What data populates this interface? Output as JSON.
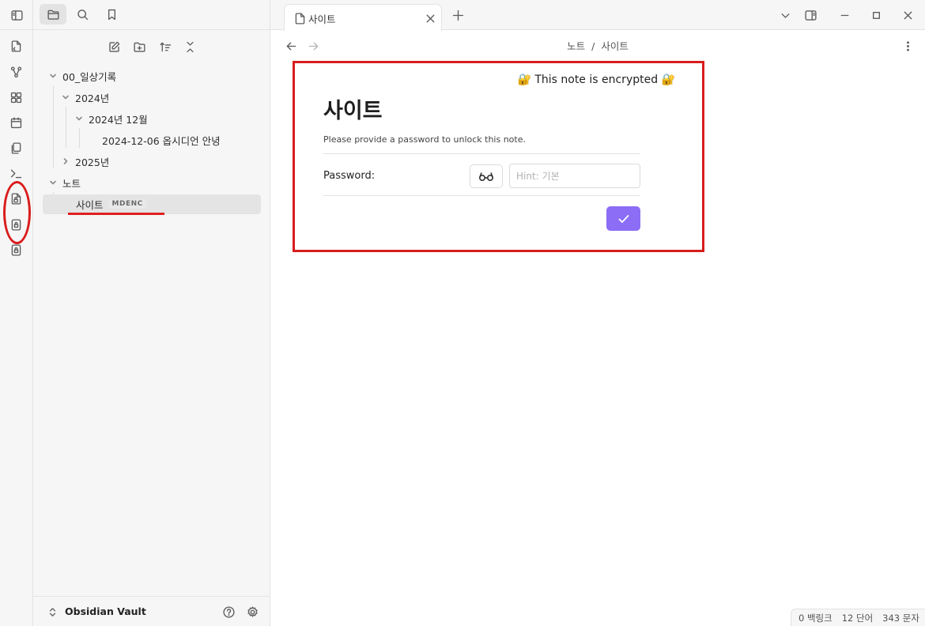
{
  "sidebar": {
    "tree": [
      {
        "label": "00_일상기록"
      },
      {
        "label": "2024년"
      },
      {
        "label": "2024년 12월"
      },
      {
        "label": "2024-12-06 옵시디언 안녕"
      },
      {
        "label": "2025년"
      },
      {
        "label": "노트"
      },
      {
        "label": "사이트",
        "badge": "MDENC"
      }
    ],
    "vault_name": "Obsidian Vault"
  },
  "tab": {
    "title": "사이트"
  },
  "breadcrumb": {
    "folder": "노트",
    "sep": "/",
    "file": "사이트"
  },
  "note": {
    "encrypted_banner": "🔐 This note is encrypted 🔐",
    "title": "사이트",
    "message": "Please provide a password to unlock this note.",
    "password_label": "Password:",
    "hint_placeholder": "Hint: 기본"
  },
  "status": {
    "backlinks": "0 백링크",
    "words": "12 단어",
    "chars": "343 문자"
  },
  "colors": {
    "accent": "#8b6ef5",
    "annotation_red": "#d91c1c"
  }
}
